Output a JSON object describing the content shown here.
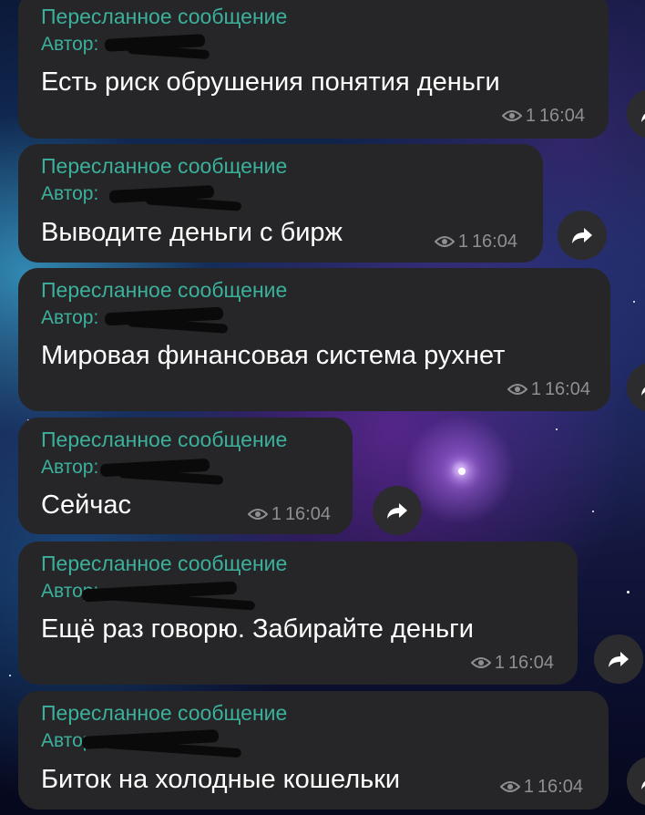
{
  "colors": {
    "bubble": "#262628",
    "forward_label": "#3bb09b",
    "text": "#ffffff",
    "meta": "#8e8e93"
  },
  "messages": [
    {
      "forwarded_label": "Пересланное сообщение",
      "author_label": "Автор:",
      "text": "Есть риск обрушения понятия деньги",
      "views": "1",
      "time": "16:04"
    },
    {
      "forwarded_label": "Пересланное сообщение",
      "author_label": "Автор:",
      "text": "Выводите деньги с бирж",
      "views": "1",
      "time": "16:04"
    },
    {
      "forwarded_label": "Пересланное сообщение",
      "author_label": "Автор:",
      "text": "Мировая финансовая система рухнет",
      "views": "1",
      "time": "16:04"
    },
    {
      "forwarded_label": "Пересланное сообщение",
      "author_label": "Автор:",
      "text": "Сейчас",
      "views": "1",
      "time": "16:04"
    },
    {
      "forwarded_label": "Пересланное сообщение",
      "author_label": "Автор:",
      "text": "Ещё раз говорю. Забирайте деньги",
      "views": "1",
      "time": "16:04"
    },
    {
      "forwarded_label": "Пересланное сообщение",
      "author_label": "Автор:",
      "text": "Биток на холодные кошельки",
      "views": "1",
      "time": "16:04"
    }
  ],
  "icons": {
    "views": "eye-icon",
    "share": "share-arrow-icon"
  }
}
